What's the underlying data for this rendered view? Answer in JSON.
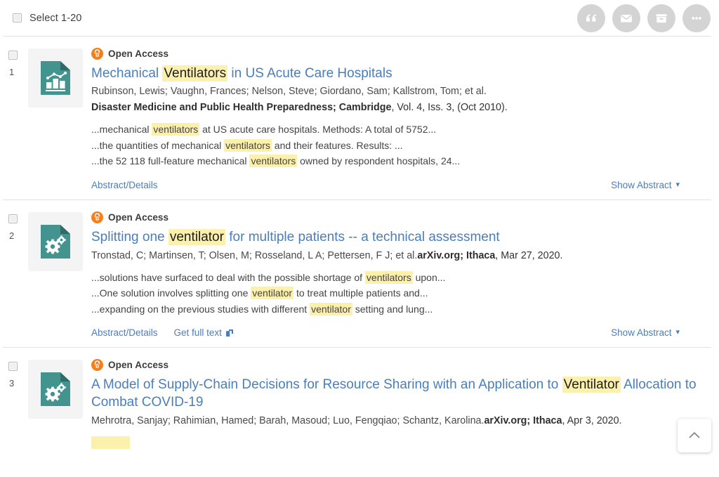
{
  "toolbar": {
    "select_all_label": "Select 1-20",
    "actions": [
      {
        "name": "cite-button",
        "icon": "quote-icon",
        "title": "Cite"
      },
      {
        "name": "email-button",
        "icon": "envelope-icon",
        "title": "Email"
      },
      {
        "name": "save-button",
        "icon": "file-box-icon",
        "title": "Save"
      },
      {
        "name": "more-button",
        "icon": "ellipsis-icon",
        "title": "More options"
      }
    ],
    "icon_bg_color": "#d4d4d4"
  },
  "colors": {
    "link": "#4a7ebb",
    "highlight": "#fcf0ad",
    "open_access": "#f08020",
    "thumb_doc": "#43948f",
    "separator": "#e2e2e2"
  },
  "labels": {
    "open_access": "Open Access",
    "abstract_details": "Abstract/Details",
    "get_full_text": "Get full text",
    "show_abstract": "Show Abstract"
  },
  "results": [
    {
      "number": "1",
      "thumb_icon": "document-bar-chart-icon",
      "open_access": true,
      "title_parts": [
        {
          "t": "Mechanical ",
          "hl": false
        },
        {
          "t": "Ventilators",
          "hl": true
        },
        {
          "t": " in US Acute Care Hospitals",
          "hl": false
        }
      ],
      "authors": "Rubinson, Lewis; Vaughn, Frances; Nelson, Steve; Giordano, Sam; Kallstrom, Tom; et al.",
      "publication": "Disaster Medicine and Public Health Preparedness; Cambridge",
      "publication_detail": ",  Vol. 4, Iss. 3, (Oct 2010).",
      "snippets": [
        [
          {
            "t": "...mechanical ",
            "hl": false
          },
          {
            "t": "ventilators",
            "hl": true
          },
          {
            "t": " at US acute care hospitals. Methods: A total of 5752...",
            "hl": false
          }
        ],
        [
          {
            "t": "...the quantities of mechanical ",
            "hl": false
          },
          {
            "t": "ventilators",
            "hl": true
          },
          {
            "t": " and their features. Results: ...",
            "hl": false
          }
        ],
        [
          {
            "t": "...the 52 118 full-feature mechanical ",
            "hl": false
          },
          {
            "t": "ventilators",
            "hl": true
          },
          {
            "t": " owned by respondent hospitals, 24...",
            "hl": false
          }
        ]
      ],
      "has_full_text": false,
      "has_show_abstract": true
    },
    {
      "number": "2",
      "thumb_icon": "document-gears-icon",
      "open_access": true,
      "title_parts": [
        {
          "t": "Splitting one ",
          "hl": false
        },
        {
          "t": "ventilator",
          "hl": true
        },
        {
          "t": " for multiple patients -- a technical assessment",
          "hl": false
        }
      ],
      "authors": "Tronstad, C; Martinsen, T; Olsen, M; Rosseland, L A; Pettersen, F J; et al.",
      "publication": "arXiv.org; Ithaca",
      "publication_detail": ", Mar 27, 2020.",
      "snippets": [
        [
          {
            "t": "...solutions have surfaced to deal with the possible shortage of ",
            "hl": false
          },
          {
            "t": "ventilators",
            "hl": true
          },
          {
            "t": " upon...",
            "hl": false
          }
        ],
        [
          {
            "t": "...One solution involves splitting one ",
            "hl": false
          },
          {
            "t": "ventilator",
            "hl": true
          },
          {
            "t": " to treat multiple patients and...",
            "hl": false
          }
        ],
        [
          {
            "t": "...expanding on the previous studies with different ",
            "hl": false
          },
          {
            "t": "ventilator",
            "hl": true
          },
          {
            "t": " setting and lung...",
            "hl": false
          }
        ]
      ],
      "has_full_text": true,
      "has_show_abstract": true
    },
    {
      "number": "3",
      "thumb_icon": "document-gears-icon",
      "open_access": true,
      "title_parts": [
        {
          "t": "A Model of Supply-Chain Decisions for Resource Sharing with an Application to ",
          "hl": false
        },
        {
          "t": "Ventilator",
          "hl": true
        },
        {
          "t": " Allocation to Combat COVID-19",
          "hl": false
        }
      ],
      "authors": "Mehrotra, Sanjay; Rahimian, Hamed; Barah, Masoud; Luo, Fengqiao; Schantz, Karolina.",
      "publication": "arXiv.org; Ithaca",
      "publication_detail": ", Apr 3, 2020.",
      "snippets": [],
      "has_full_text": false,
      "has_show_abstract": false
    }
  ],
  "scroll_to_top": {
    "icon": "chevron-up-icon",
    "title": "Back to top"
  }
}
